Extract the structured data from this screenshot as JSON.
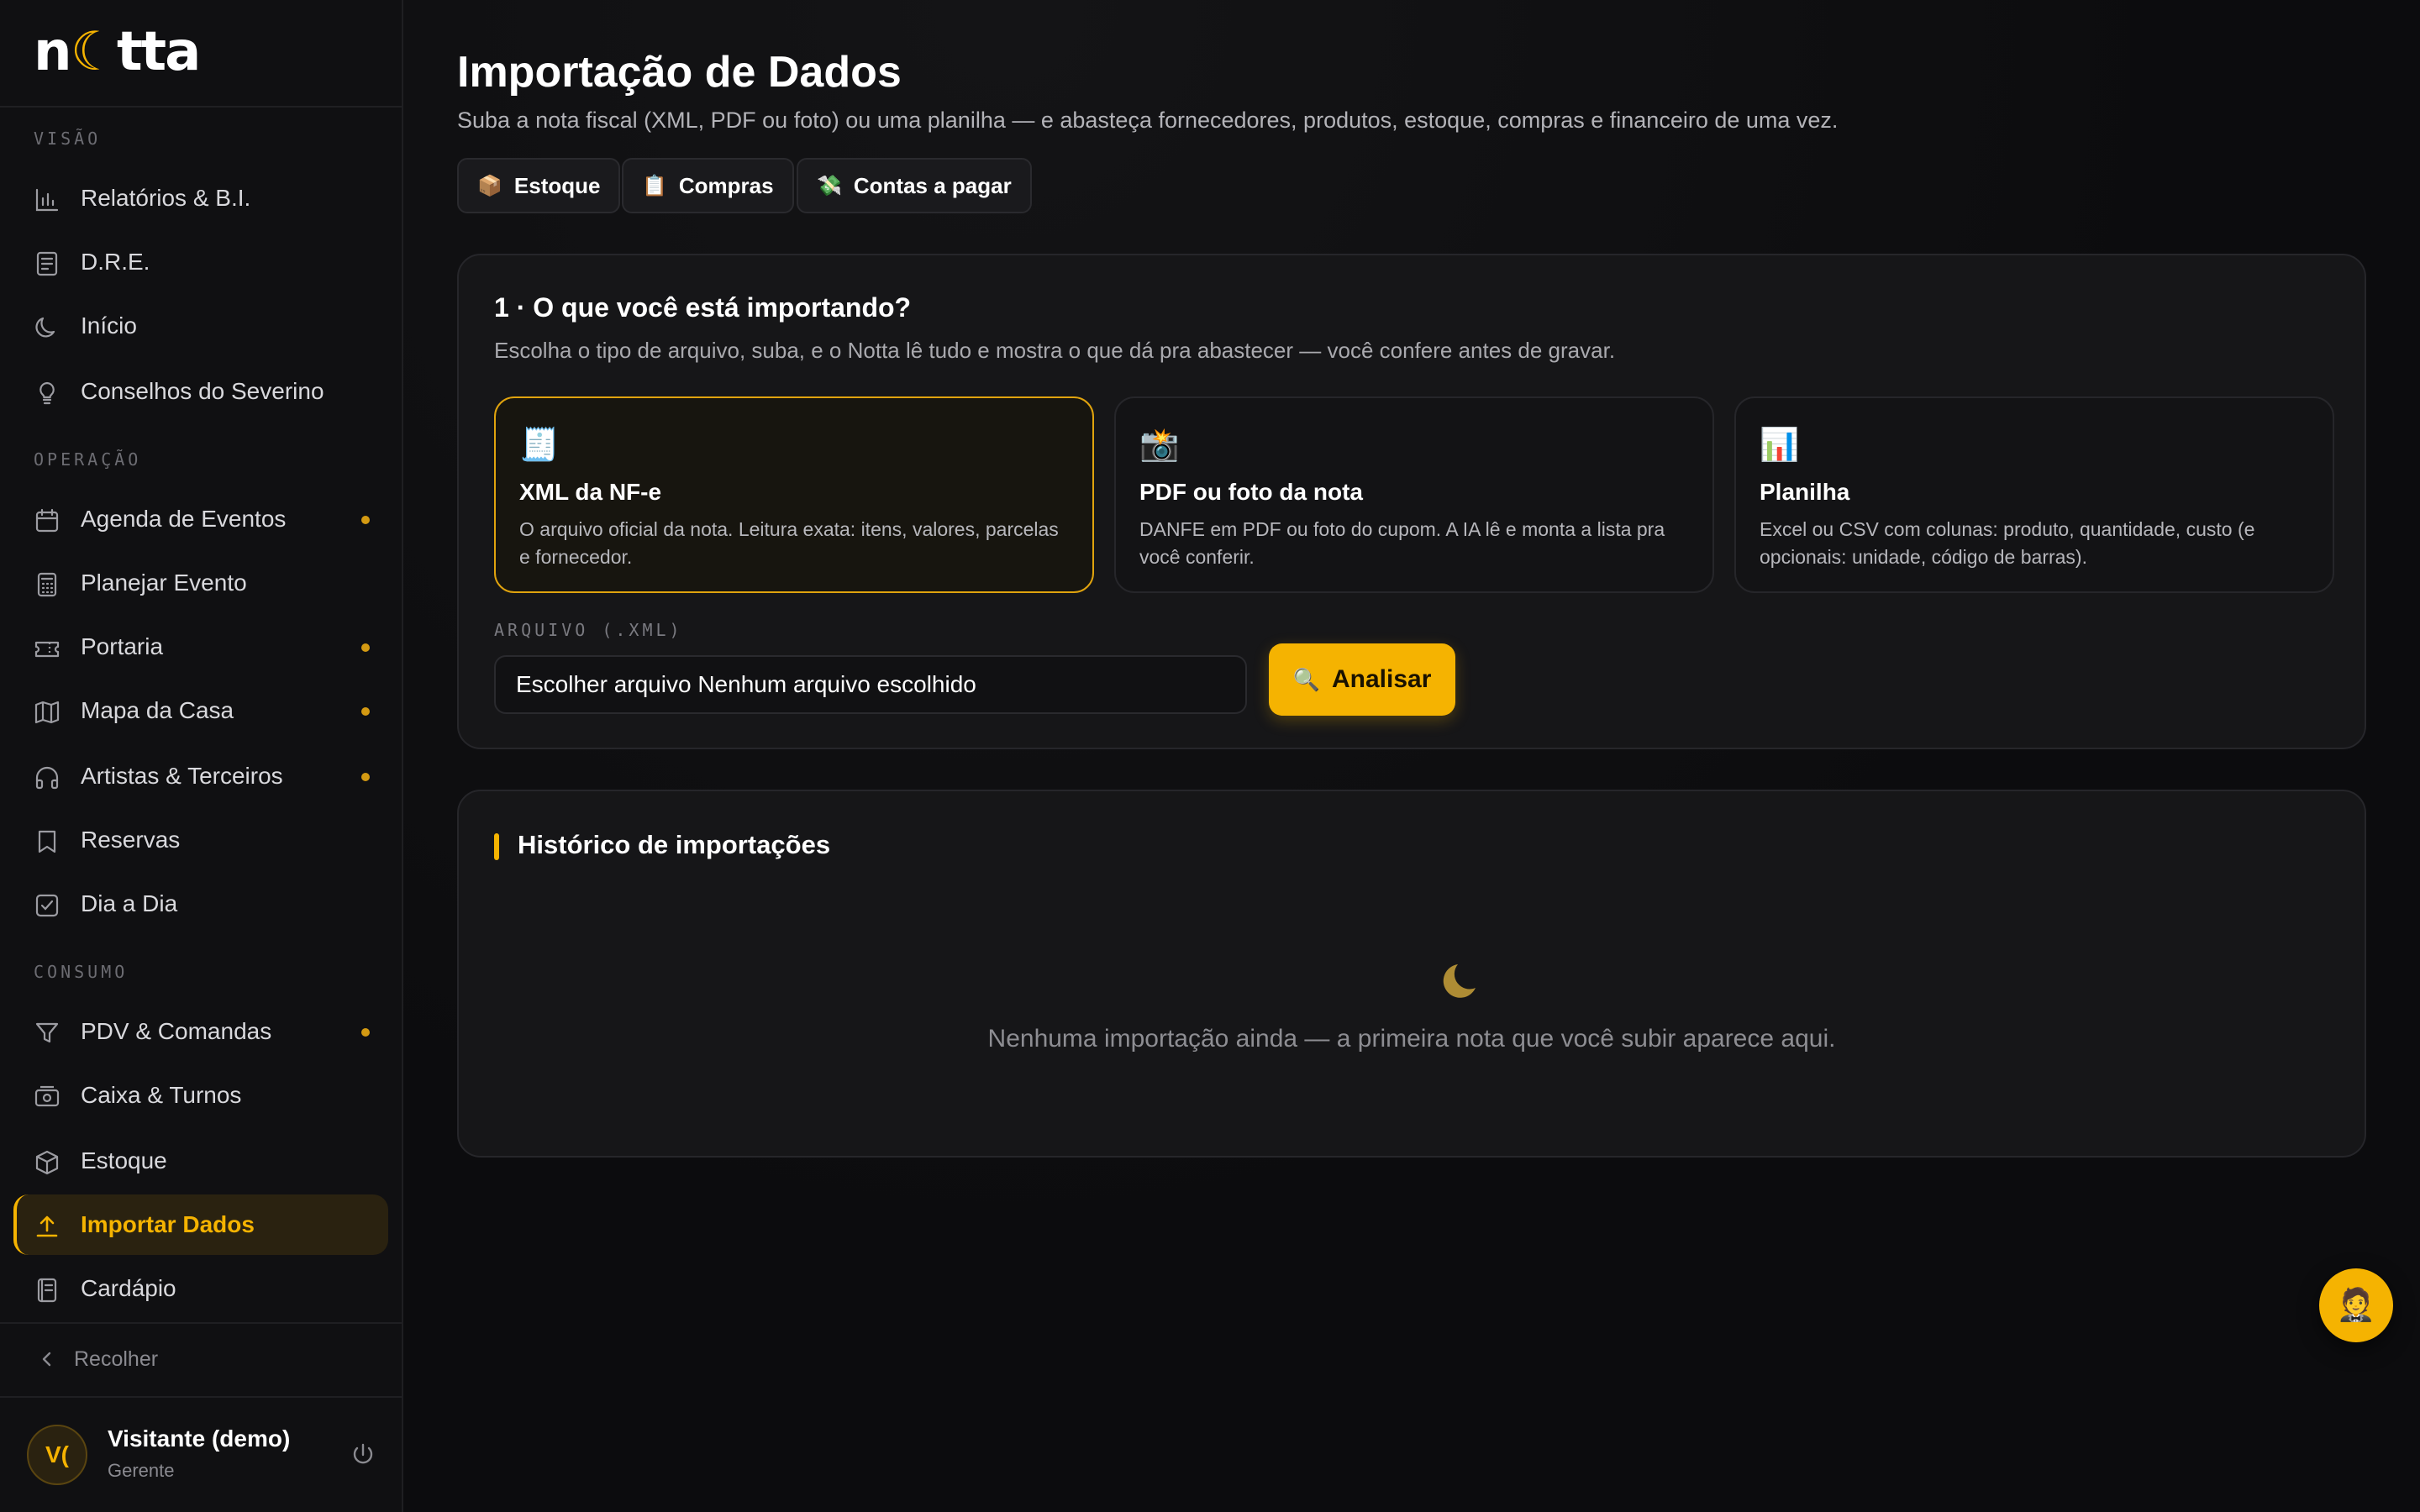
{
  "brand": {
    "logo_pre": "n",
    "logo_moon": "☾",
    "logo_post": "tta"
  },
  "sidebar": {
    "sections": {
      "visao": "VISÃO",
      "operacao": "OPERAÇÃO",
      "consumo": "CONSUMO"
    },
    "items": [
      {
        "label": "Relatórios & B.I.",
        "icon": "bar-chart-icon",
        "dot": false
      },
      {
        "label": "D.R.E.",
        "icon": "document-icon",
        "dot": false
      },
      {
        "label": "Início",
        "icon": "moon-icon",
        "dot": false
      },
      {
        "label": "Conselhos do Severino",
        "icon": "lightbulb-icon",
        "dot": false
      },
      {
        "label": "Agenda de Eventos",
        "icon": "calendar-icon",
        "dot": true
      },
      {
        "label": "Planejar Evento",
        "icon": "calculator-icon",
        "dot": false
      },
      {
        "label": "Portaria",
        "icon": "ticket-icon",
        "dot": true
      },
      {
        "label": "Mapa da Casa",
        "icon": "map-icon",
        "dot": true
      },
      {
        "label": "Artistas & Terceiros",
        "icon": "headphones-icon",
        "dot": true
      },
      {
        "label": "Reservas",
        "icon": "bookmark-icon",
        "dot": false
      },
      {
        "label": "Dia a Dia",
        "icon": "checkbox-icon",
        "dot": false
      },
      {
        "label": "PDV & Comandas",
        "icon": "filter-icon",
        "dot": true
      },
      {
        "label": "Caixa & Turnos",
        "icon": "cash-register-icon",
        "dot": false
      },
      {
        "label": "Estoque",
        "icon": "box-icon",
        "dot": false
      },
      {
        "label": "Importar Dados",
        "icon": "upload-icon",
        "dot": false
      },
      {
        "label": "Cardápio",
        "icon": "menu-book-icon",
        "dot": false
      }
    ],
    "collapse_label": "Recolher",
    "user": {
      "initials": "V(",
      "name": "Visitante (demo)",
      "role": "Gerente"
    }
  },
  "page": {
    "title": "Importação de Dados",
    "subtitle": "Suba a nota fiscal (XML, PDF ou foto) ou uma planilha — e abasteça fornecedores, produtos, estoque, compras e financeiro de uma vez.",
    "quick_links": [
      {
        "emoji": "📦",
        "label": "Estoque"
      },
      {
        "emoji": "📋",
        "label": "Compras"
      },
      {
        "emoji": "💸",
        "label": "Contas a pagar"
      }
    ]
  },
  "import_card": {
    "title": "1 · O que você está importando?",
    "subtitle": "Escolha o tipo de arquivo, suba, e o Notta lê tudo e mostra o que dá pra abastecer — você confere antes de gravar.",
    "options": [
      {
        "emoji": "🧾",
        "title": "XML da NF-e",
        "description": "O arquivo oficial da nota. Leitura exata: itens, valores, parcelas e fornecedor.",
        "selected": true
      },
      {
        "emoji": "📸",
        "title": "PDF ou foto da nota",
        "description": "DANFE em PDF ou foto do cupom. A IA lê e monta a lista pra você conferir.",
        "selected": false
      },
      {
        "emoji": "📊",
        "title": "Planilha",
        "description": "Excel ou CSV com colunas: produto, quantidade, custo (e opcionais: unidade, código de barras).",
        "selected": false
      }
    ],
    "file_label": "ARQUIVO (.XML)",
    "file_input_text": "Escolher arquivo Nenhum arquivo escolhido",
    "analyze_emoji": "🔍",
    "analyze_label": "Analisar"
  },
  "history": {
    "title": "Histórico de importações",
    "empty_text": "Nenhuma importação ainda — a primeira nota que você subir aparece aqui."
  },
  "fab": {
    "emoji": "🤵"
  },
  "colors": {
    "accent": "#f5b301",
    "background": "#0c0c0e",
    "sidebar": "#101012",
    "card": "#161618"
  }
}
